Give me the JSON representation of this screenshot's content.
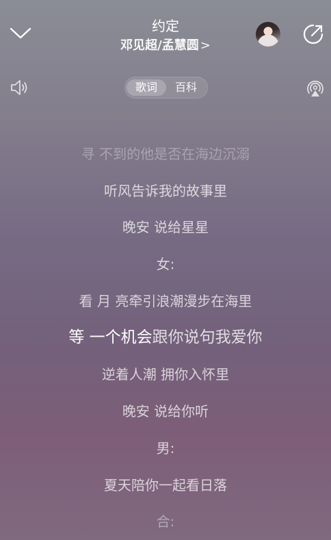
{
  "player": {
    "song_title": "约定",
    "artists": "邓见超/孟慧圆",
    "artist_chevron": ">"
  },
  "tabs": [
    {
      "label": "歌词",
      "selected": true
    },
    {
      "label": "百科",
      "selected": false
    }
  ],
  "lyrics": {
    "lines": [
      "寻 不到的他是否在海边沉溺",
      "听风告诉我的故事里",
      "晚安 说给星星",
      "女:",
      "看 月 亮牵引浪潮漫步在海里",
      "等 一个机会跟你说句我爱你",
      "逆着人潮 拥你入怀里",
      "晚安 说给你听",
      "男:",
      "夏天陪你一起看日落",
      "合:"
    ],
    "active_index": 5,
    "active_sung": "等 一个机会",
    "active_rest": "跟你说句我爱你"
  },
  "colors": {
    "background_top": "#8a8d96",
    "background_mid": "#766a83",
    "background_bottom": "#7e5e78",
    "text": "#ffffff"
  },
  "icons": {
    "back": "chevron-down-icon",
    "share": "share-icon",
    "volume": "speaker-icon",
    "airplay": "airplay-icon"
  }
}
